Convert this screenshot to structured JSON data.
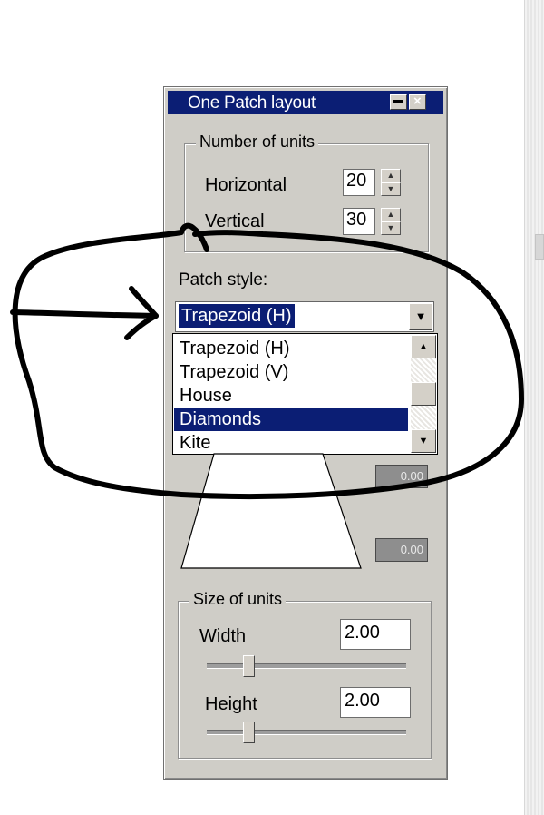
{
  "window": {
    "title": "One Patch layout",
    "minimize_icon": "minimize-icon",
    "close_icon": "close-icon",
    "close_glyph": "×"
  },
  "number_of_units": {
    "legend": "Number of units",
    "horizontal": {
      "label": "Horizontal",
      "value": "20"
    },
    "vertical": {
      "label": "Vertical",
      "value": "30"
    }
  },
  "patch_style": {
    "label": "Patch style:",
    "selected": "Trapezoid (H)",
    "options": [
      "Trapezoid (H)",
      "Trapezoid (V)",
      "House",
      "Diamonds",
      "Kite"
    ],
    "highlighted_option": "Diamonds"
  },
  "preview": {
    "top_value": "0.00",
    "bottom_value": "0.00"
  },
  "size_of_units": {
    "legend": "Size of units",
    "width": {
      "label": "Width",
      "value": "2.00",
      "slider_fraction": 0.18
    },
    "height": {
      "label": "Height",
      "value": "2.00",
      "slider_fraction": 0.18
    }
  },
  "colors": {
    "titlebar": "#0b1e74",
    "panel": "#cfcdc7",
    "selection": "#0b1e74",
    "annotation_ink": "#000000"
  }
}
